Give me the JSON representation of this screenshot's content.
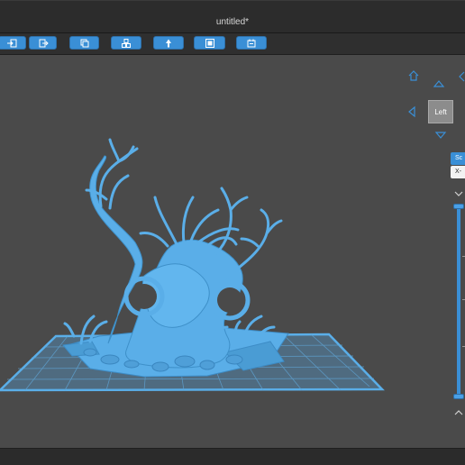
{
  "window": {
    "title": "untitled*"
  },
  "toolbar": {
    "buttons": [
      {
        "name": "import-button",
        "icon": "file-import-icon"
      },
      {
        "name": "export-button",
        "icon": "file-export-icon"
      },
      {
        "name": "copy-button",
        "icon": "copy-icon"
      },
      {
        "name": "arrange-button",
        "icon": "arrange-icon"
      },
      {
        "name": "supports-button",
        "icon": "support-tree-icon"
      },
      {
        "name": "layer-view-button",
        "icon": "layer-square-icon"
      },
      {
        "name": "slice-button",
        "icon": "slice-icon"
      }
    ]
  },
  "viewport": {
    "view_label": "Left",
    "panel": {
      "button_label": "Sc",
      "field_value": "X-"
    },
    "layer_slider": {
      "min_position": 0,
      "max_position": 1
    }
  },
  "colors": {
    "accent": "#3a8fd6",
    "model": "#5aaee8",
    "background": "#4a4a4a",
    "toolbar": "#2f2f2f"
  }
}
